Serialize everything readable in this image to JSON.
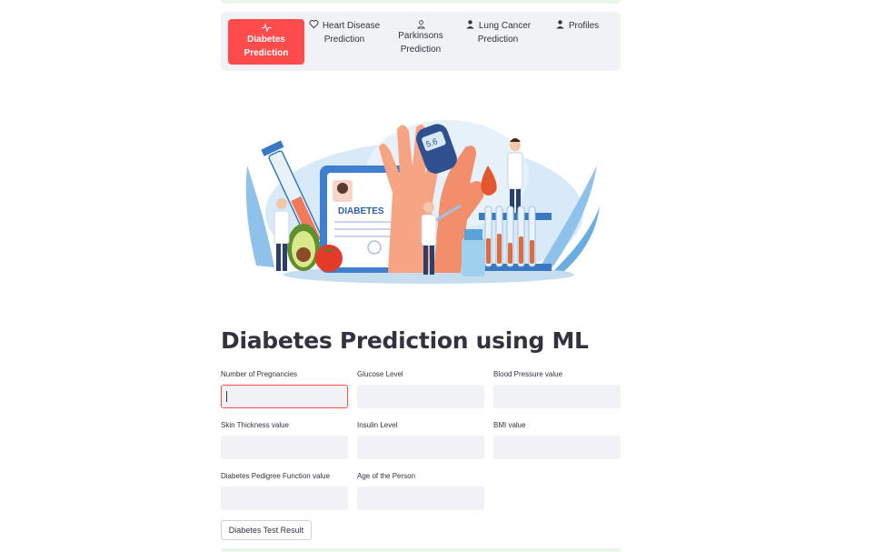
{
  "nav": {
    "items": [
      {
        "label": "Diabetes Prediction",
        "icon": "activity-icon",
        "active": true
      },
      {
        "label": "Heart Disease Prediction",
        "icon": "heart-icon",
        "active": false
      },
      {
        "label": "Parkinsons Prediction",
        "icon": "person-icon",
        "active": false
      },
      {
        "label": "Lung Cancer Prediction",
        "icon": "person-fill-icon",
        "active": false
      },
      {
        "label": "Profiles",
        "icon": "person-fill-icon",
        "active": false
      }
    ],
    "active_color": "#ff4b4b"
  },
  "hero": {
    "sign_text": "DIABETES",
    "meter_reading": "5.6"
  },
  "page": {
    "title": "Diabetes Prediction using ML"
  },
  "form": {
    "fields": [
      {
        "label": "Number of Pregnancies",
        "value": ""
      },
      {
        "label": "Glucose Level",
        "value": ""
      },
      {
        "label": "Blood Pressure value",
        "value": ""
      },
      {
        "label": "Skin Thickness value",
        "value": ""
      },
      {
        "label": "Insulin Level",
        "value": ""
      },
      {
        "label": "BMI value",
        "value": ""
      },
      {
        "label": "Diabetes Pedigree Function value",
        "value": ""
      },
      {
        "label": "Age of the Person",
        "value": ""
      }
    ],
    "submit_label": "Diabetes Test Result"
  }
}
